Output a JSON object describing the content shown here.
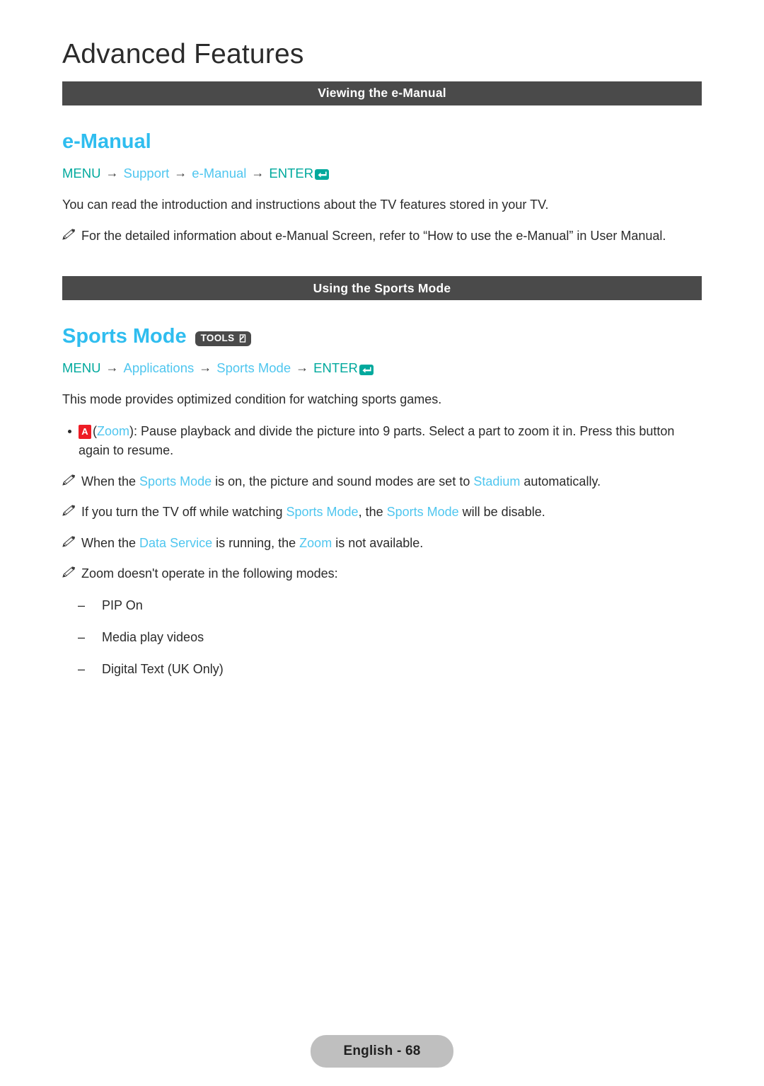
{
  "page": {
    "title": "Advanced Features",
    "footer_label": "English - 68"
  },
  "colors": {
    "heading_blue": "#2fbdef",
    "link_blue": "#4fc6ef",
    "nav_teal": "#00a99d",
    "bar_gray": "#4a4a4a",
    "body_text": "#2b2b2b",
    "key_red": "#ee1c25",
    "footer_badge": "#bfbfbf"
  },
  "sections": [
    {
      "bar_title": "Viewing the e-Manual",
      "heading": "e-Manual",
      "nav_path": {
        "menu": "MENU",
        "arrow": "→",
        "step1": "Support",
        "step2": "e-Manual",
        "enter": "ENTER",
        "enter_icon": "enter-return-icon"
      },
      "paragraph": "You can read the introduction and instructions about the TV features stored in your TV.",
      "notes": [
        {
          "icon": "pencil-note-icon",
          "text": "For the detailed information about e-Manual Screen, refer to “How to use the e-Manual” in User Manual."
        }
      ]
    },
    {
      "bar_title": "Using the Sports Mode",
      "heading": "Sports Mode",
      "badge": {
        "label": "TOOLS",
        "icon": "tools-arrow-icon"
      },
      "nav_path": {
        "menu": "MENU",
        "arrow": "→",
        "step1": "Applications",
        "step2": "Sports Mode",
        "enter": "ENTER",
        "enter_icon": "enter-return-icon"
      },
      "paragraph": "This mode provides optimized condition for watching sports games.",
      "bullet": {
        "key": "A",
        "key_color": "#ee1c25",
        "open_paren": "(",
        "link": "Zoom",
        "close_paren": "):",
        "text": " Pause playback and divide the picture into 9 parts. Select a part to zoom it in. Press this button again to resume."
      },
      "notes": [
        {
          "icon": "pencil-note-icon",
          "parts": [
            {
              "t": "When the ",
              "hl": false
            },
            {
              "t": "Sports Mode",
              "hl": true
            },
            {
              "t": " is on, the picture and sound modes are set to ",
              "hl": false
            },
            {
              "t": "Stadium",
              "hl": true
            },
            {
              "t": " automatically.",
              "hl": false
            }
          ]
        },
        {
          "icon": "pencil-note-icon",
          "parts": [
            {
              "t": "If you turn the TV off while watching ",
              "hl": false
            },
            {
              "t": "Sports Mode",
              "hl": true
            },
            {
              "t": ", the ",
              "hl": false
            },
            {
              "t": "Sports Mode",
              "hl": true
            },
            {
              "t": " will be disable.",
              "hl": false
            }
          ]
        },
        {
          "icon": "pencil-note-icon",
          "parts": [
            {
              "t": "When the ",
              "hl": false
            },
            {
              "t": "Data Service",
              "hl": true
            },
            {
              "t": " is running, the ",
              "hl": false
            },
            {
              "t": "Zoom",
              "hl": true
            },
            {
              "t": " is not available.",
              "hl": false
            }
          ]
        },
        {
          "icon": "pencil-note-icon",
          "parts": [
            {
              "t": "Zoom doesn't operate in the following modes:",
              "hl": false
            }
          ]
        }
      ],
      "dash_list": {
        "mark": "–",
        "items": [
          "PIP On",
          "Media play videos",
          "Digital Text (UK Only)"
        ]
      }
    }
  ]
}
